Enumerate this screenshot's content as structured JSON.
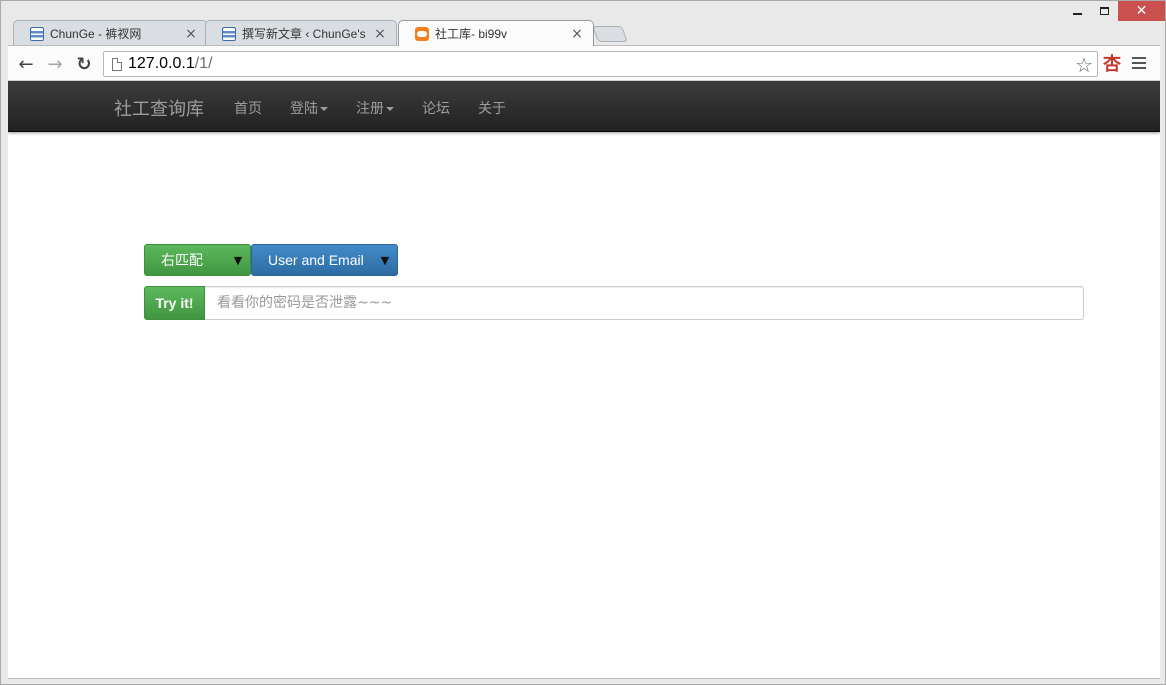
{
  "browser": {
    "tabs": [
      {
        "title": "ChunGe - 裤衩网",
        "icon": "doc-favicon",
        "active": false
      },
      {
        "title": "撰写新文章 ‹ ChunGe's B",
        "icon": "doc-favicon",
        "active": false
      },
      {
        "title": "社工库- bi99v",
        "icon": "cloud-favicon",
        "active": true
      }
    ],
    "close_glyph": "×",
    "url_host": "127.0.0.1",
    "url_path": "/1/",
    "extension_glyph": "杏",
    "star_glyph": "☆",
    "back_glyph": "←",
    "forward_glyph": "→",
    "reload_glyph": "↻",
    "window_close_glyph": "✕"
  },
  "navbar": {
    "brand": "社工查询库",
    "items": [
      {
        "label": "首页",
        "dropdown": false
      },
      {
        "label": "登陆",
        "dropdown": true
      },
      {
        "label": "注册",
        "dropdown": true
      },
      {
        "label": "论坛",
        "dropdown": false
      },
      {
        "label": "关于",
        "dropdown": false
      }
    ]
  },
  "search": {
    "match_label": "右匹配",
    "scope_label": "User and Email",
    "dropdown_glyph": "▼",
    "try_label": "Try it!",
    "placeholder": "看看你的密码是否泄露~~~",
    "value": ""
  },
  "colors": {
    "green": "#5cb85c",
    "blue": "#428bca",
    "navbar": "#222222",
    "close_red": "#c9504e"
  }
}
